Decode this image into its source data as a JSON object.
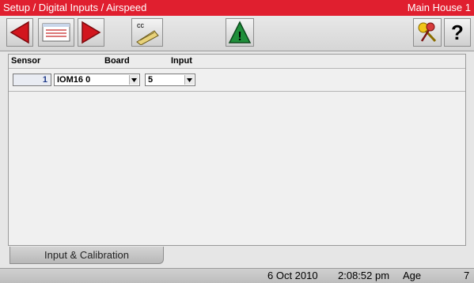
{
  "title_bar": {
    "path": "Setup / Digital Inputs / Airspeed",
    "house": "Main House 1",
    "bg_color": "#e01f2f"
  },
  "toolbar": {
    "buttons": [
      {
        "icon": "arrow-left-icon"
      },
      {
        "icon": "list-icon"
      },
      {
        "icon": "arrow-right-icon"
      },
      {
        "icon": "clipboard-cc-icon",
        "label": "cc"
      },
      {
        "icon": "warning-icon",
        "label": "!"
      },
      {
        "icon": "keys-icon"
      },
      {
        "icon": "help-icon",
        "label": "?"
      }
    ]
  },
  "table": {
    "headers": {
      "sensor": "Sensor",
      "board": "Board",
      "input": "Input"
    },
    "rows": [
      {
        "sensor": "1",
        "board": "IOM16 0",
        "input": "5"
      }
    ]
  },
  "tab": {
    "label": "Input & Calibration"
  },
  "status_bar": {
    "date": "6 Oct 2010",
    "time": "2:08:52 pm",
    "age_label": "Age",
    "age_value": "7"
  }
}
